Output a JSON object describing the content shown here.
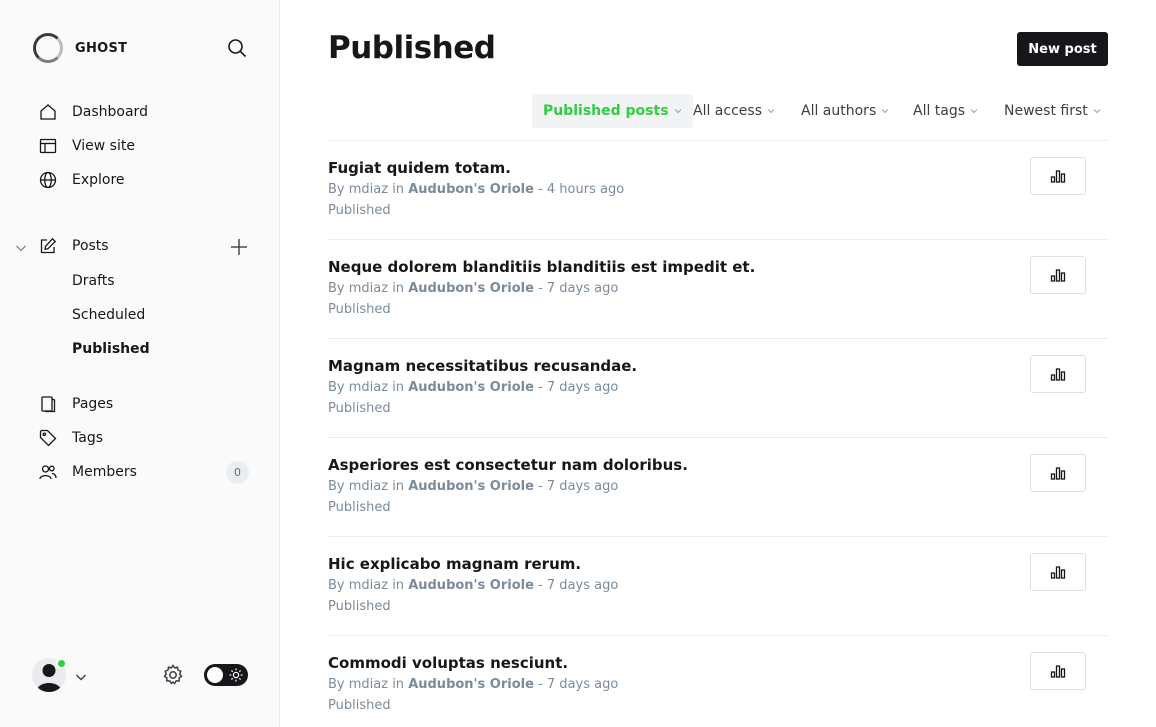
{
  "brand": {
    "name": "GHOST"
  },
  "sidebar": {
    "nav": [
      {
        "label": "Dashboard",
        "icon": "home-icon"
      },
      {
        "label": "View site",
        "icon": "layout-icon"
      },
      {
        "label": "Explore",
        "icon": "globe-icon"
      }
    ],
    "posts": {
      "label": "Posts",
      "sub": [
        "Drafts",
        "Scheduled",
        "Published"
      ],
      "active": "Published"
    },
    "secondary": [
      {
        "label": "Pages",
        "icon": "pages-icon"
      },
      {
        "label": "Tags",
        "icon": "tag-icon"
      },
      {
        "label": "Members",
        "icon": "members-icon",
        "count": "0"
      }
    ]
  },
  "main": {
    "title": "Published",
    "new_post_label": "New post",
    "filters": [
      "Published posts",
      "All access",
      "All authors",
      "All tags",
      "Newest first"
    ],
    "active_filter": "Published posts",
    "posts": [
      {
        "title": "Fugiat quidem totam.",
        "by": "By mdiaz in",
        "tag": "Audubon's Oriole",
        "time": "- 4 hours ago",
        "status": "Published"
      },
      {
        "title": "Neque dolorem blanditiis blanditiis est impedit et.",
        "by": "By mdiaz in",
        "tag": "Audubon's Oriole",
        "time": "- 7 days ago",
        "status": "Published"
      },
      {
        "title": "Magnam necessitatibus recusandae.",
        "by": "By mdiaz in",
        "tag": "Audubon's Oriole",
        "time": "- 7 days ago",
        "status": "Published"
      },
      {
        "title": "Asperiores est consectetur nam doloribus.",
        "by": "By mdiaz in",
        "tag": "Audubon's Oriole",
        "time": "- 7 days ago",
        "status": "Published"
      },
      {
        "title": "Hic explicabo magnam rerum.",
        "by": "By mdiaz in",
        "tag": "Audubon's Oriole",
        "time": "- 7 days ago",
        "status": "Published"
      },
      {
        "title": "Commodi voluptas nesciunt.",
        "by": "By mdiaz in",
        "tag": "Audubon's Oriole",
        "time": "- 7 days ago",
        "status": "Published"
      }
    ]
  },
  "colors": {
    "accent": "#30cf43",
    "text": "#15171a",
    "muted": "#7c8b9a",
    "button": "#15171a"
  }
}
